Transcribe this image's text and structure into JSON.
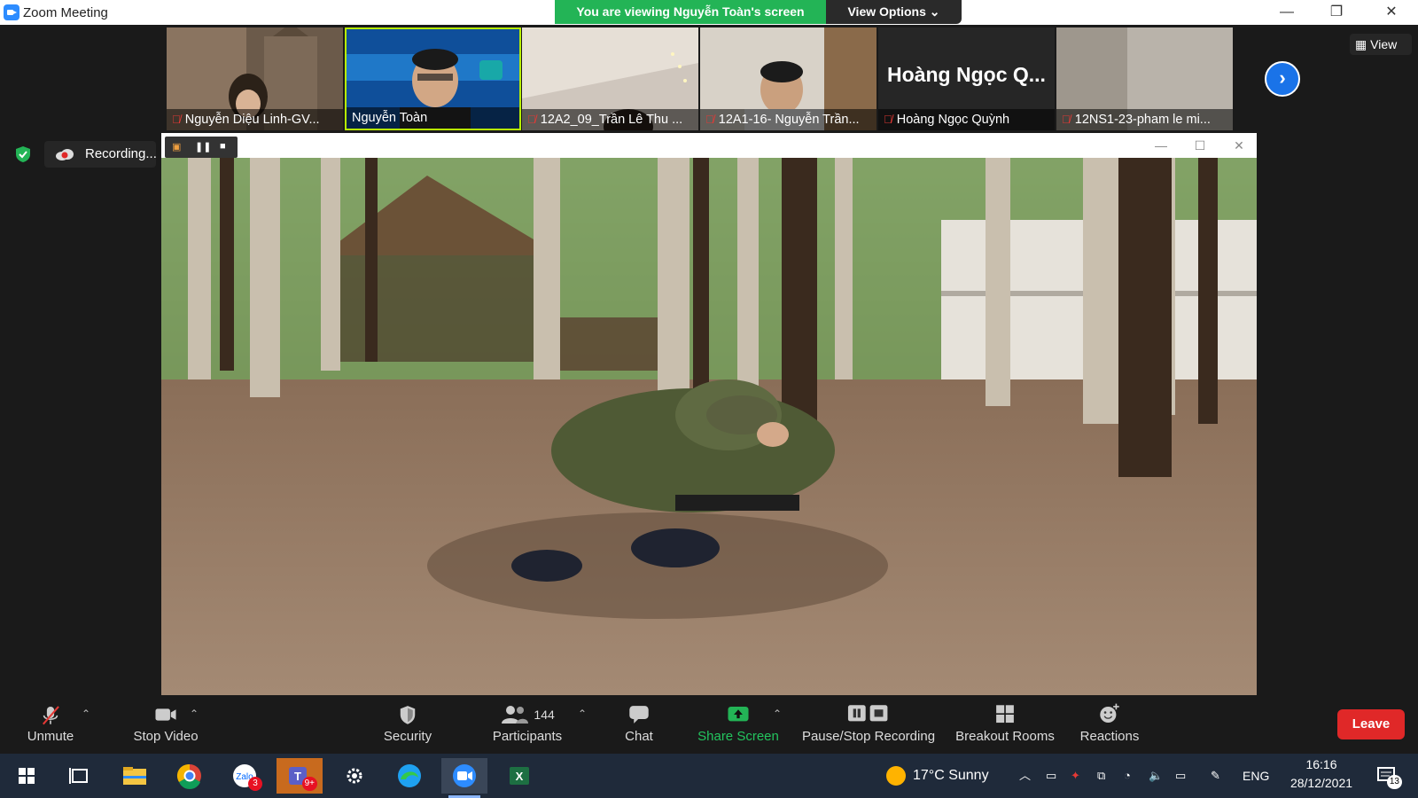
{
  "window": {
    "title": "Zoom Meeting"
  },
  "banner": {
    "viewing_text": "You are viewing Nguyễn Toàn's screen",
    "view_options": "View Options ⌄"
  },
  "participants_strip": [
    {
      "name": "Nguyễn Diệu Linh-GV...",
      "muted": true
    },
    {
      "name": "Nguyễn Toàn",
      "muted": false,
      "active": true
    },
    {
      "name": "12A2_09_Trần Lê Thu ...",
      "muted": true
    },
    {
      "name": "12A1-16- Nguyễn Trần...",
      "muted": true
    },
    {
      "name": "Hoàng Ngọc Quỳnh",
      "muted": true,
      "big_label": "Hoàng Ngọc Q..."
    },
    {
      "name": "12NS1-23-pham le mi...",
      "muted": true
    }
  ],
  "view_button": "View",
  "recording": {
    "label": "Recording..."
  },
  "toolbar": {
    "unmute": "Unmute",
    "stop_video": "Stop Video",
    "security": "Security",
    "participants": "Participants",
    "participants_count": "144",
    "chat": "Chat",
    "share_screen": "Share Screen",
    "pause_stop_recording": "Pause/Stop Recording",
    "breakout_rooms": "Breakout Rooms",
    "reactions": "Reactions",
    "leave": "Leave"
  },
  "taskbar": {
    "zalo_badge": "3",
    "teams_badge": "9+",
    "weather": "17°C  Sunny",
    "language": "ENG",
    "time": "16:16",
    "date": "28/12/2021",
    "notifications": "13"
  },
  "colors": {
    "accent_green": "#23b456",
    "zoom_blue": "#2d8cff",
    "leave_red": "#e02828"
  }
}
